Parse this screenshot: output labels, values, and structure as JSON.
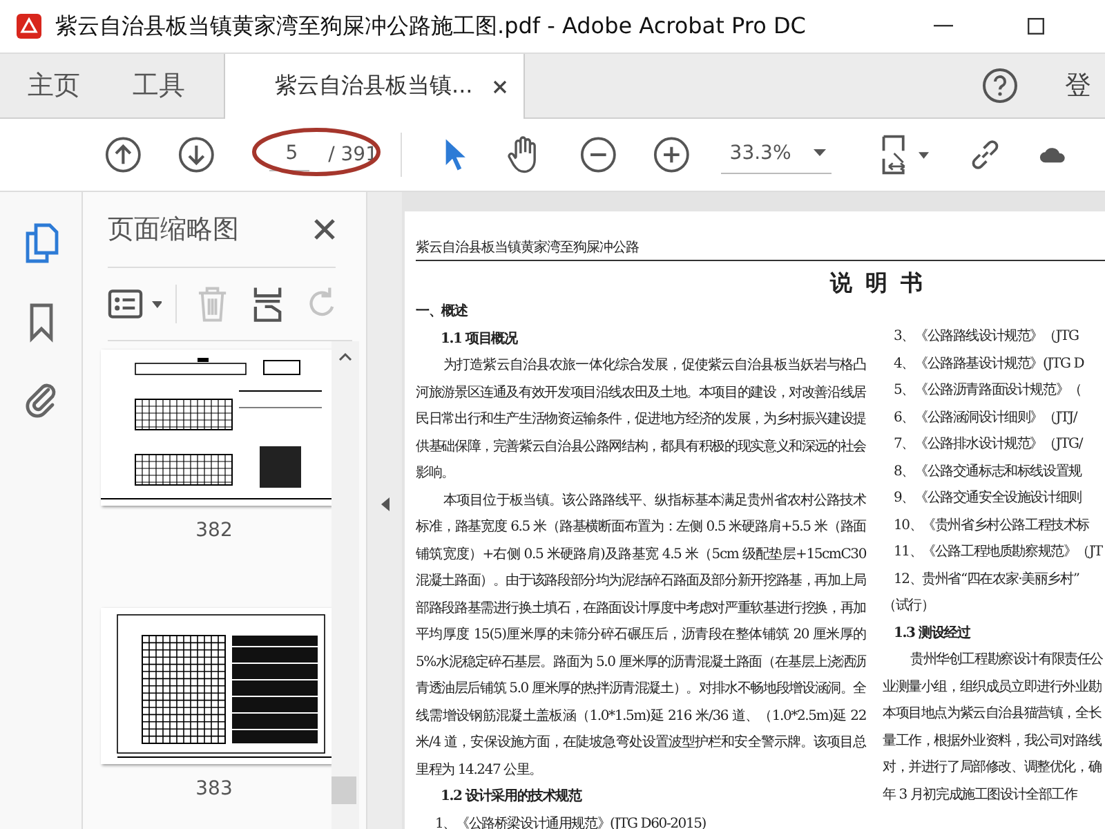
{
  "window": {
    "title": "紫云自治县板当镇黄家湾至狗屎冲公路施工图.pdf - Adobe Acrobat Pro DC"
  },
  "menu": [
    {
      "label": "主页"
    },
    {
      "label": "工具"
    }
  ],
  "document_tab": {
    "label": "紫云自治县板当镇..."
  },
  "account": {
    "label": "登"
  },
  "toolbar": {
    "page_number": "5",
    "page_count": "/ 391",
    "zoom": "33.3%"
  },
  "side_icons": [
    {
      "kind": "pages",
      "selected": true
    },
    {
      "kind": "bookmarks",
      "selected": false
    },
    {
      "kind": "attachments",
      "selected": false
    }
  ],
  "thumbnails_panel": {
    "title": "页面缩略图",
    "tools": [
      {
        "kind": "delete",
        "disabled": true
      },
      {
        "kind": "extract",
        "disabled": false
      },
      {
        "kind": "rotate",
        "disabled": true
      }
    ],
    "thumbnails": [
      {
        "kind": "plan",
        "label": "382"
      },
      {
        "kind": "table",
        "label": "383"
      }
    ]
  },
  "document": {
    "running_header": "紫云自治县板当镇黄家湾至狗屎冲公路",
    "title": "说 明 书",
    "left_column": [
      {
        "kind": "heading",
        "text": "一、概述"
      },
      {
        "kind": "subheading",
        "text": "1.1 项目概况"
      },
      {
        "kind": "paragraph",
        "text": "为打造紫云自治县农旅一体化综合发展，促使紫云自治县板当妖岩与格凸河旅游景区连通及有效开发项目沿线农田及土地。本项目的建设，对改善沿线居民日常出行和生产生活物资运输条件，促进地方经济的发展，为乡村振兴建设提供基础保障，完善紫云自治县公路网结构，都具有积极的现实意义和深远的社会影响。"
      },
      {
        "kind": "paragraph",
        "text": "本项目位于板当镇。该公路路线平、纵指标基本满足贵州省农村公路技术标准，路基宽度 6.5 米（路基横断面布置为：左侧 0.5 米硬路肩+5.5 米（路面铺筑宽度）+右侧 0.5 米硬路肩)及路基宽 4.5 米（5cm 级配垫层+15cmC30 混凝土路面）。由于该路段部分均为泥结碎石路面及部分新开挖路基，再加上局部路段路基需进行换土填石，在路面设计厚度中考虑对严重软基进行挖换，再加平均厚度 15(5)厘米厚的未筛分碎石碾压后，沥青段在整体铺筑 20 厘米厚的 5%水泥稳定碎石基层。路面为 5.0 厘米厚的沥青混凝土路面（在基层上浇洒沥青透油层后铺筑 5.0 厘米厚的热拌沥青混凝土）。对排水不畅地段增设涵洞。全线需增设钢筋混凝土盖板涵（1.0*1.5m)延 216 米/36 道、（1.0*2.5m)延 22 米/4 道，安保设施方面，在陡坡急弯处设置波型护栏和安全警示牌。该项目总里程为 14.247 公里。"
      },
      {
        "kind": "subheading",
        "text": "1.2 设计采用的技术规范"
      },
      {
        "kind": "item",
        "text": "1、《公路桥梁设计通用规范》(JTG D60-2015)"
      }
    ],
    "right_column": [
      {
        "kind": "item",
        "text": "3、《公路路线设计规范》（JTG"
      },
      {
        "kind": "item",
        "text": "4、《公路路基设计规范》(JTG D"
      },
      {
        "kind": "item",
        "text": "5、《公路沥青路面设计规范》（"
      },
      {
        "kind": "item",
        "text": "6、《公路涵洞设计细则》（JTJ/"
      },
      {
        "kind": "item",
        "text": "7、《公路排水设计规范》（JTG/"
      },
      {
        "kind": "item",
        "text": "8、《公路交通标志和标线设置规"
      },
      {
        "kind": "item",
        "text": "9、《公路交通安全设施设计细则"
      },
      {
        "kind": "item",
        "text": "10、《贵州省乡村公路工程技术标"
      },
      {
        "kind": "item",
        "text": "11、《公路工程地质勘察规范》（JT"
      },
      {
        "kind": "item",
        "text": "12、贵州省“四在农家·美丽乡村”"
      },
      {
        "kind": "plain",
        "text": "（试行）"
      },
      {
        "kind": "subheading",
        "text": "1.3 测设经过"
      },
      {
        "kind": "indent",
        "text": "贵州华创工程勘察设计有限责任公"
      },
      {
        "kind": "plain",
        "text": "业测量小组，组织成员立即进行外业勘"
      },
      {
        "kind": "plain",
        "text": "本项目地点为紫云自治县猫营镇，全长"
      },
      {
        "kind": "plain",
        "text": "量工作，根据外业资料，我公司对路线"
      },
      {
        "kind": "plain",
        "text": "对，并进行了局部修改、调整优化，确"
      },
      {
        "kind": "plain",
        "text": "年 3 月初完成施工图设计全部工作"
      }
    ]
  }
}
